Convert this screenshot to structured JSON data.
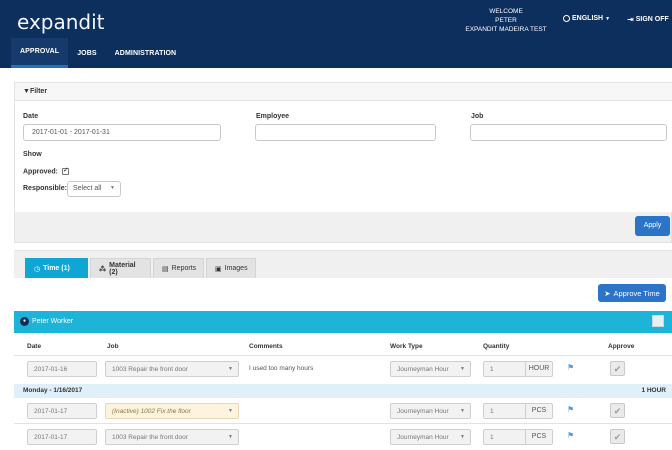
{
  "app": {
    "logo": "expandit",
    "welcome_lines": [
      "WELCOME",
      "PETER",
      "EXPANDIT MADEIRA TEST"
    ],
    "language_label": "ENGLISH",
    "signoff_label": "SIGN OFF"
  },
  "nav": {
    "items": [
      {
        "label": "APPROVAL",
        "active": true
      },
      {
        "label": "JOBS",
        "active": false
      },
      {
        "label": "ADMINISTRATION",
        "active": false
      }
    ]
  },
  "filter": {
    "title": "Filter",
    "date_label": "Date",
    "date_value": "2017-01-01 - 2017-01-31",
    "employee_label": "Employee",
    "employee_value": "",
    "job_label": "Job",
    "job_value": "",
    "show_label": "Show",
    "approved_label": "Approved:",
    "approved_checked": true,
    "responsible_label": "Responsible:",
    "responsible_value": "Select all",
    "apply_label": "Apply"
  },
  "tabs": [
    {
      "label": "Time (1)",
      "icon": "clock-icon",
      "active": true
    },
    {
      "label": "Material (2)",
      "icon": "sitemap-icon",
      "active": false
    },
    {
      "label": "Reports",
      "icon": "file-icon",
      "active": false
    },
    {
      "label": "Images",
      "icon": "image-icon",
      "active": false
    }
  ],
  "approve_time_label": "Approve Time",
  "worker": {
    "name": "Peter Worker"
  },
  "columns": {
    "date": "Date",
    "job": "Job",
    "comments": "Comments",
    "work_type": "Work Type",
    "quantity": "Quantity",
    "approve": "Approve"
  },
  "rows": [
    {
      "date": "2017-01-16",
      "job": "1003 Repair the front door",
      "comment": "I used too many hours",
      "work_type": "Journeyman Hour",
      "quantity": "1",
      "unit": "HOUR",
      "inactive": false
    },
    {
      "date": "2017-01-17",
      "job": "(Inactive) 1002 Fix the floor",
      "comment": "",
      "work_type": "Journeyman Hour",
      "quantity": "1",
      "unit": "PCS",
      "inactive": true
    },
    {
      "date": "2017-01-17",
      "job": "1003 Repair the front door",
      "comment": "",
      "work_type": "Journeyman Hour",
      "quantity": "1",
      "unit": "PCS",
      "inactive": false
    }
  ],
  "day_group": {
    "label": "Monday - 1/16/2017",
    "total": "1 HOUR"
  },
  "colors": {
    "header_bg": "#0d2f5e",
    "accent_blue": "#2b74c7",
    "cyan": "#1db4d8"
  }
}
